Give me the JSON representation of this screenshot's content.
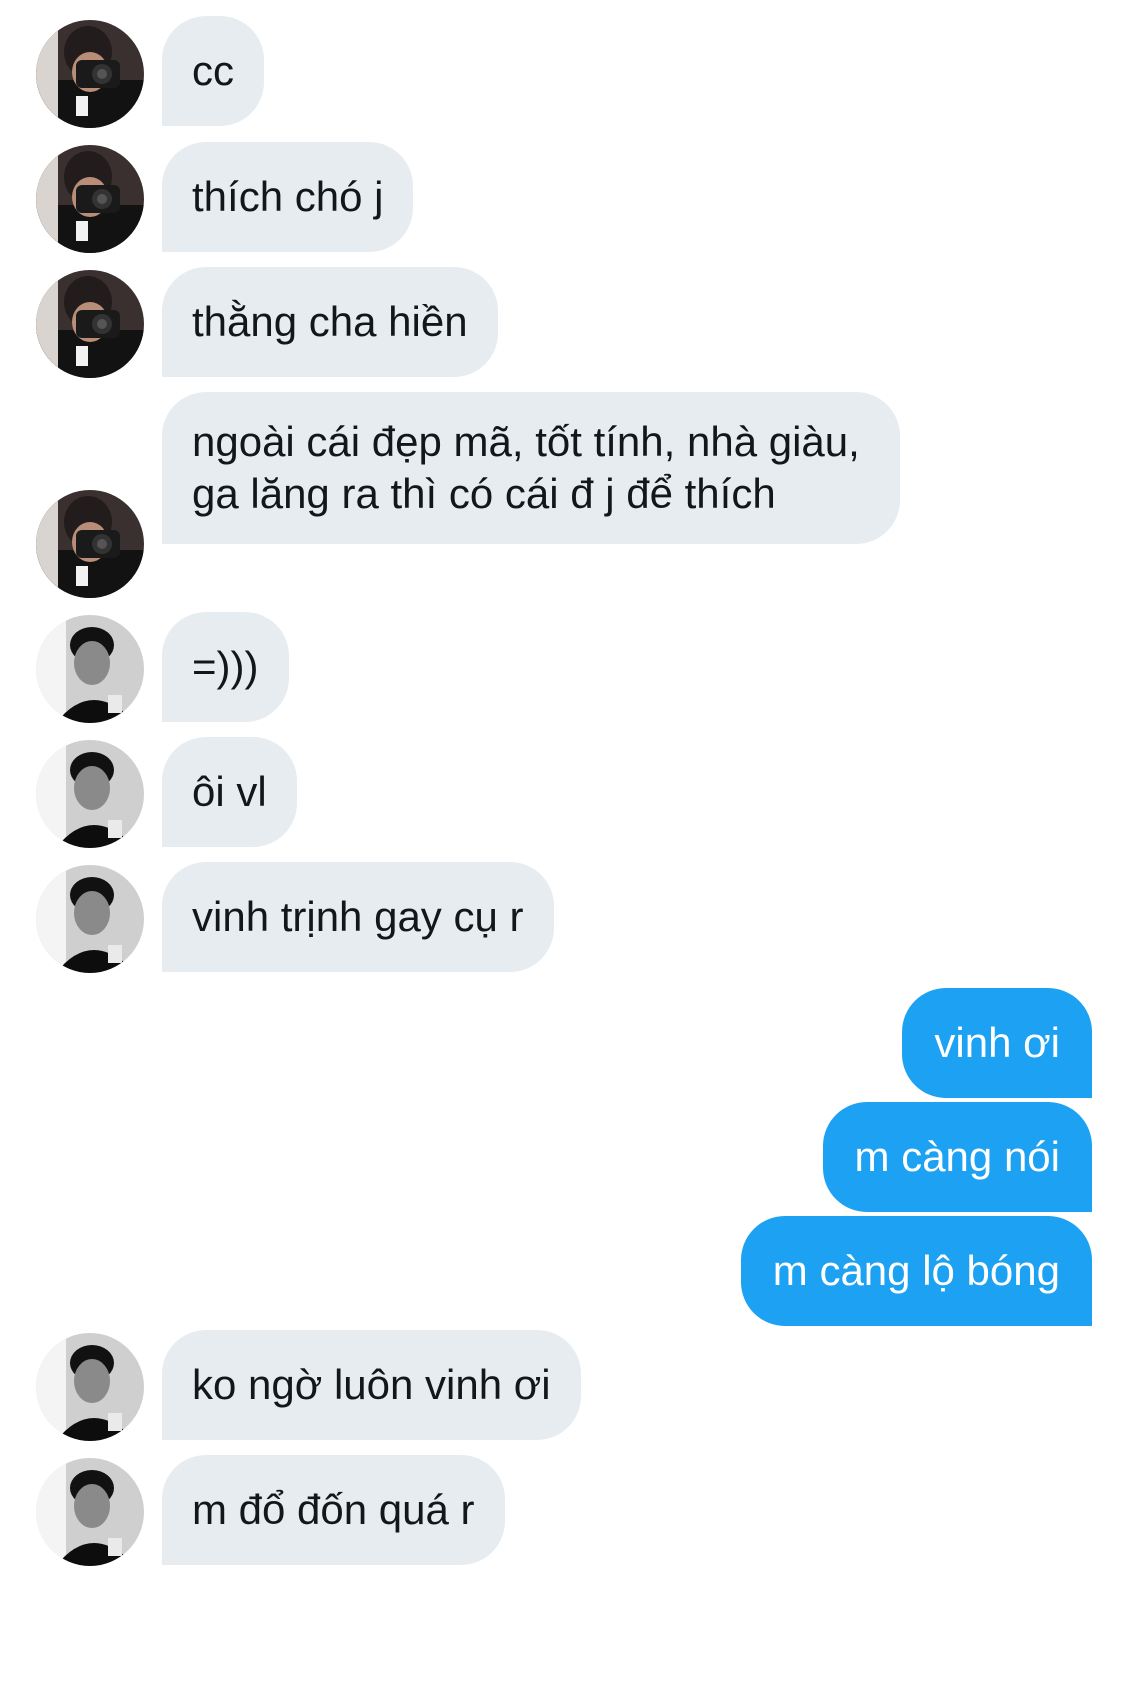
{
  "conversation": {
    "messages": [
      {
        "side": "in",
        "sender": "a",
        "text": "cc"
      },
      {
        "side": "in",
        "sender": "a",
        "text": "thích chó j"
      },
      {
        "side": "in",
        "sender": "a",
        "text": "thằng cha hiền"
      },
      {
        "side": "in",
        "sender": "a",
        "text": "ngoài cái đẹp mã, tốt tính, nhà giàu, ga lăng ra thì có cái đ j để thích"
      },
      {
        "side": "in",
        "sender": "b",
        "text": "=)))"
      },
      {
        "side": "in",
        "sender": "b",
        "text": "ôi vl"
      },
      {
        "side": "in",
        "sender": "b",
        "text": "vinh trịnh gay cụ r"
      },
      {
        "side": "out",
        "sender": "me",
        "text": "vinh ơi"
      },
      {
        "side": "out",
        "sender": "me",
        "text": "m càng nói"
      },
      {
        "side": "out",
        "sender": "me",
        "text": "m càng lộ bóng"
      },
      {
        "side": "in",
        "sender": "b",
        "text": "ko ngờ luôn vinh ơi"
      },
      {
        "side": "in",
        "sender": "b",
        "text": "m đổ đốn quá r"
      }
    ]
  },
  "colors": {
    "incoming_bubble": "#e6ecf0",
    "outgoing_bubble": "#1da1f2",
    "incoming_text": "#14171a",
    "outgoing_text": "#ffffff"
  },
  "avatars": {
    "a": {
      "icon": "avatar-camera-person-icon"
    },
    "b": {
      "icon": "avatar-man-portrait-icon"
    }
  }
}
